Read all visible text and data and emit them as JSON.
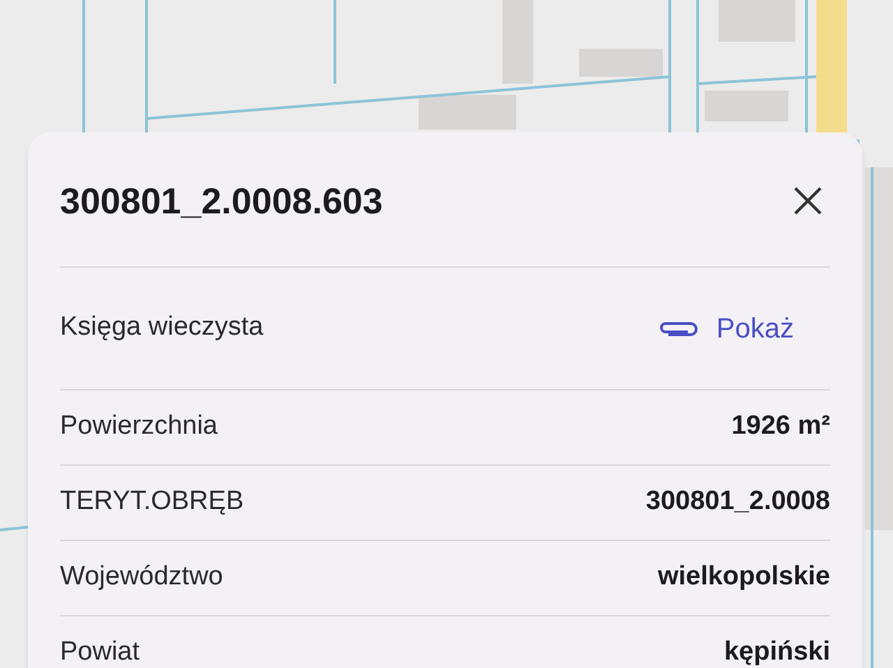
{
  "parcel_card": {
    "title": "300801_2.0008.603",
    "rows": [
      {
        "kind": "link",
        "label": "Księga wieczysta",
        "value": "Pokaż"
      },
      {
        "kind": "text",
        "label": "Powierzchnia",
        "value": "1926 m²"
      },
      {
        "kind": "text",
        "label": "TERYT.OBRĘB",
        "value": "300801_2.0008"
      },
      {
        "kind": "text",
        "label": "Województwo",
        "value": "wielkopolskie"
      },
      {
        "kind": "text",
        "label": "Powiat",
        "value": "kępiński"
      }
    ]
  }
}
